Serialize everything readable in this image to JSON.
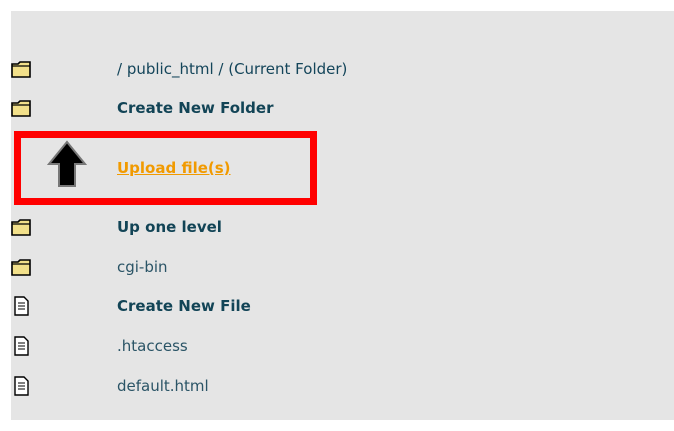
{
  "rows": [
    {
      "label": "/ public_html / (Current Folder)",
      "icon": "folder-icon",
      "style": "normal"
    },
    {
      "label": "Create New Folder",
      "icon": "folder-icon",
      "style": "bold"
    },
    {
      "label": "Upload file(s)",
      "icon": "up-arrow-icon",
      "style": "upload"
    },
    {
      "label": "Up one level",
      "icon": "folder-icon",
      "style": "bold"
    },
    {
      "label": "cgi-bin",
      "icon": "folder-icon",
      "style": "normal"
    },
    {
      "label": "Create New File",
      "icon": "file-icon",
      "style": "bold"
    },
    {
      "label": ".htaccess",
      "icon": "file-icon",
      "style": "normal"
    },
    {
      "label": "default.html",
      "icon": "file-icon",
      "style": "normal"
    }
  ],
  "colors": {
    "panel_bg": "#e5e5e5",
    "text": "#14455a",
    "upload_link": "#f19a00",
    "highlight_border": "#ff0000",
    "folder_fill": "#f2e08a"
  }
}
